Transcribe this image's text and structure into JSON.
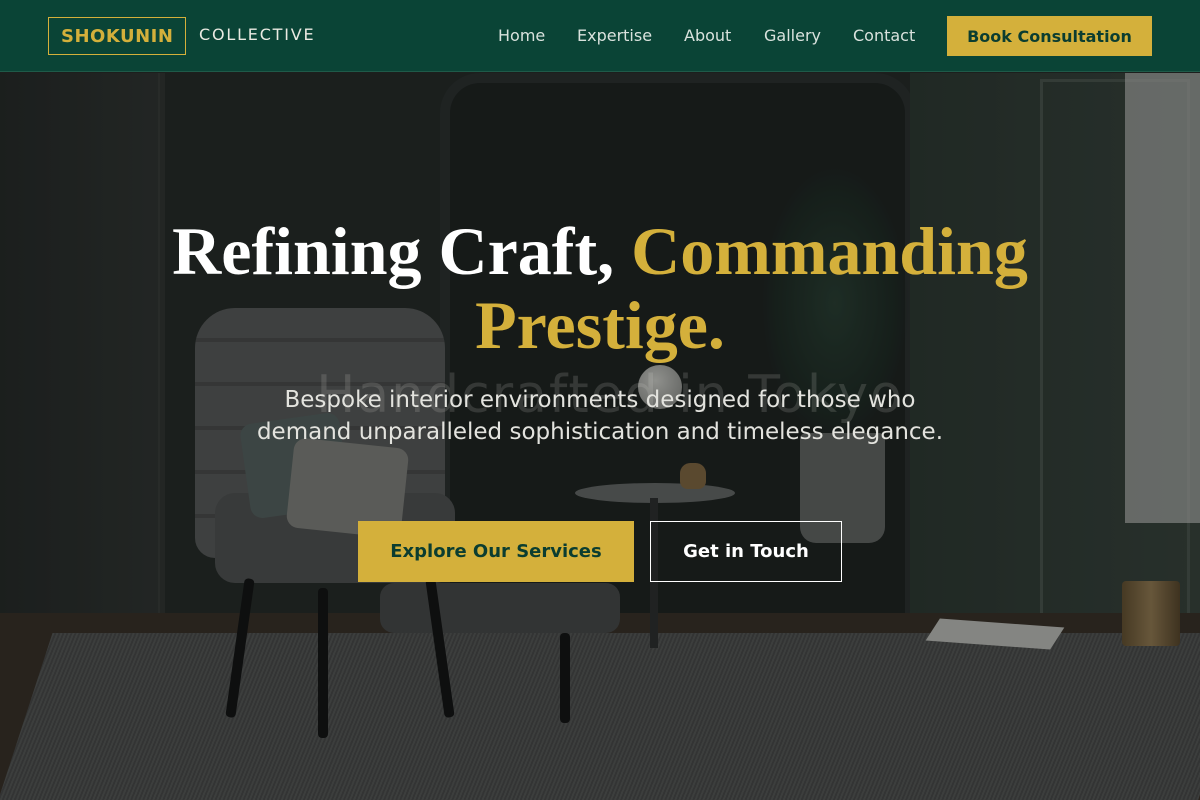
{
  "brand": {
    "logo_text": "SHOKUNIN",
    "logo_sub": "COLLECTIVE"
  },
  "nav": {
    "items": [
      {
        "label": "Home"
      },
      {
        "label": "Expertise"
      },
      {
        "label": "About"
      },
      {
        "label": "Gallery"
      },
      {
        "label": "Contact"
      }
    ],
    "cta_label": "Book Consultation"
  },
  "hero": {
    "title_white": "Refining Craft, ",
    "title_gold_1": "Commanding",
    "title_gold_2": "Prestige.",
    "subtitle": "Bespoke interior environments designed for those who demand unparalleled sophistication and timeless elegance.",
    "primary_button": "Explore Our Services",
    "secondary_button": "Get in Touch",
    "watermark": "Handcrafted in Tokyo"
  },
  "colors": {
    "header_bg": "#0a4436",
    "accent_gold": "#d4b03b",
    "text_white": "#ffffff"
  }
}
